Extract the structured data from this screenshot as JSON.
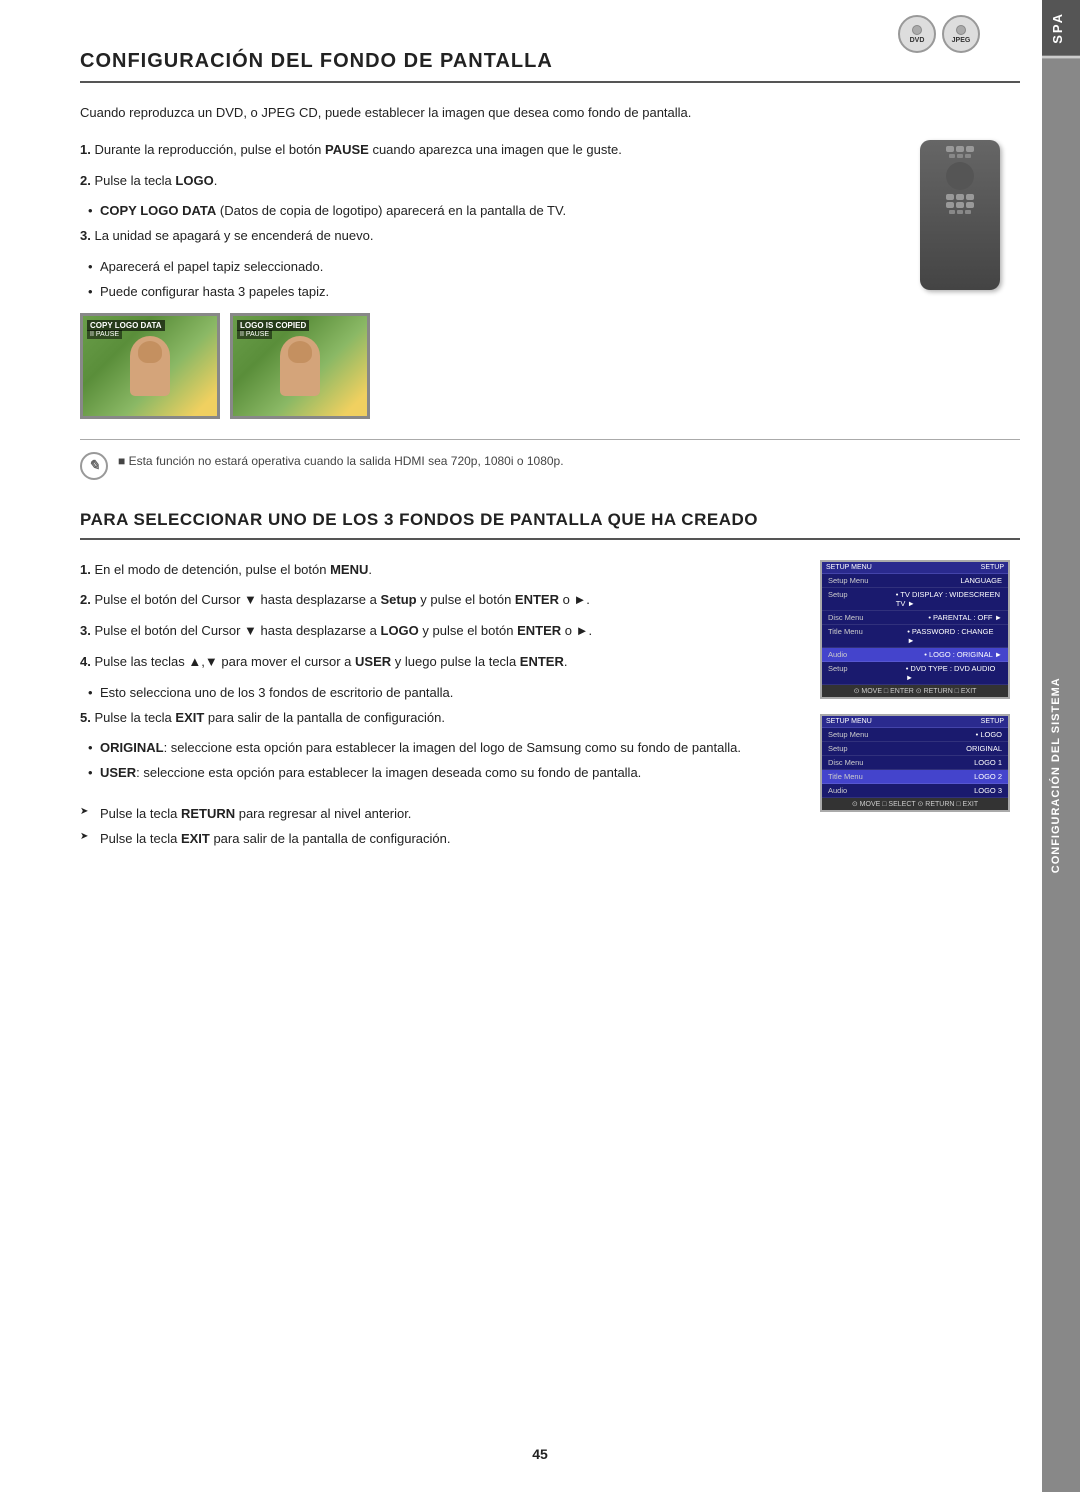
{
  "page": {
    "number": "45",
    "sidebar_top": "SPA",
    "sidebar_main": "CONFIGURACIÓN DEL SISTEMA"
  },
  "section1": {
    "title": "CONFIGURACIÓN DEL FONDO DE PANTALLA",
    "intro": "Cuando reproduzca un DVD, o JPEG CD, puede establecer la imagen que desea como fondo de pantalla.",
    "steps": [
      {
        "num": "1.",
        "text": "Durante la reproducción, pulse el botón ",
        "bold": "PAUSE",
        "text2": " cuando aparezca una imagen que le guste."
      },
      {
        "num": "2.",
        "text": "Pulse la tecla ",
        "bold": "LOGO",
        "text2": "."
      }
    ],
    "bullet1": {
      "label": "COPY LOGO DATA",
      "text": " (Datos de copia de logotipo) aparecerá en la pantalla de TV."
    },
    "step3": {
      "num": "3.",
      "text": "La unidad se apagará y se encenderá de nuevo."
    },
    "bullets": [
      "Aparecerá el papel tapiz seleccionado.",
      "Puede configurar hasta 3 papeles tapiz."
    ],
    "screen_labels": {
      "screen1_top": "COPY LOGO DATA",
      "screen1_sub": "II PAUSE",
      "screen2_top": "LOGO IS COPIED",
      "screen2_sub": "II PAUSE"
    },
    "note": "Esta función no estará operativa cuando la salida HDMI sea 720p, 1080i o 1080p."
  },
  "section2": {
    "title": "PARA SELECCIONAR UNO DE LOS 3 FONDOS DE PANTALLA QUE HA CREADO",
    "steps": [
      {
        "num": "1.",
        "text": "En el modo de detención, pulse el botón ",
        "bold": "MENU",
        "text2": "."
      },
      {
        "num": "2.",
        "text": "Pulse el botón del Cursor ▼ hasta desplazarse a ",
        "bold": "Setup",
        "text2": " y pulse el botón ",
        "bold2": "ENTER",
        "text3": " o ►."
      },
      {
        "num": "3.",
        "text": "Pulse el botón del Cursor ▼ hasta desplazarse a ",
        "bold": "LOGO",
        "text2": " y pulse el botón ",
        "bold2": "ENTER",
        "text3": " o ►."
      },
      {
        "num": "4.",
        "text": "Pulse las teclas ▲,▼ para mover el cursor a ",
        "bold": "USER",
        "text2": " y luego pulse la tecla ",
        "bold2": "ENTER",
        "text3": "."
      }
    ],
    "bullet4": "Esto selecciona uno de los 3 fondos de escritorio de pantalla.",
    "step5": {
      "num": "5.",
      "text": "Pulse la tecla ",
      "bold": "EXIT",
      "text2": " para salir de la pantalla de configuración."
    },
    "original_label": "ORIGINAL",
    "original_text": ": seleccione esta opción para establecer la imagen del logo de Samsung como su fondo de pantalla.",
    "user_label": "USER",
    "user_text": ": seleccione esta opción para establecer la imagen deseada como su fondo de pantalla.",
    "tips": [
      "Pulse la tecla RETURN para regresar al nivel anterior.",
      "Pulse la tecla EXIT para salir de la pantalla de configuración."
    ],
    "menu1": {
      "header_left": "SETUP MENU",
      "header_right": "SETUP",
      "rows": [
        {
          "left": "Setup Menu",
          "right": "",
          "sub": "LANGUAGE"
        },
        {
          "left": "Setup",
          "right": "• TV DISPLAY  : WIDESCREEN TV  ►"
        },
        {
          "left": "Disc Menu",
          "right": "• PARENTAL     : OFF             ►"
        },
        {
          "left": "Title Menu",
          "right": "• PASSWORD    : CHANGE          ►"
        },
        {
          "left": "Audio",
          "right": "• LOGO           : ORIGINAL        ►",
          "highlighted": true
        },
        {
          "left": "Setup",
          "right": "• DVD TYPE    : DVD AUDIO      ►"
        }
      ],
      "footer": "⊙ MOVE  □ ENTER  ⊙ RETURN  □ EXIT"
    },
    "menu2": {
      "header_left": "SETUP MENU",
      "header_right": "SETUP",
      "rows": [
        {
          "left": "Setup Menu",
          "right": "• LOGO"
        },
        {
          "left": "Setup",
          "right": "ORIGINAL"
        },
        {
          "left": "Disc Menu",
          "right": ""
        },
        {
          "left": "Title Menu",
          "right": "LOGO 1"
        },
        {
          "left": "",
          "right": "LOGO 2"
        },
        {
          "left": "Audio",
          "right": "LOGO 3",
          "highlighted": true
        }
      ],
      "footer": "⊙ MOVE  □ SELECT  ⊙ RETURN  □ EXIT"
    }
  },
  "icons": {
    "dvd_label": "DVD",
    "jpeg_label": "JPEG",
    "note_symbol": "✎"
  }
}
